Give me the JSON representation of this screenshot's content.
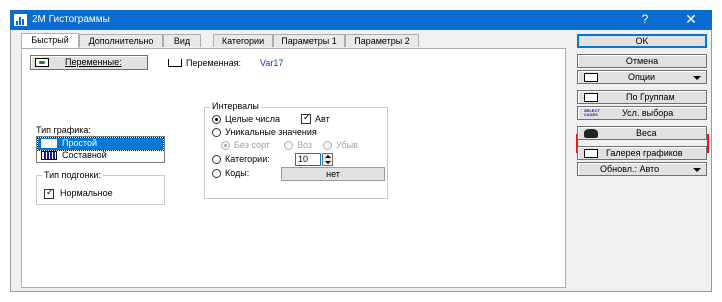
{
  "window": {
    "title": "2M Гистограммы",
    "help_label": "?",
    "close_label": "✕"
  },
  "tabs": [
    "Быстрый",
    "Дополнительно",
    "Вид",
    "Категории",
    "Параметры 1",
    "Параметры 2"
  ],
  "quick": {
    "variables_button": "Переменные:",
    "variable_label": "Переменная:",
    "variable_value": "Var17",
    "graph_type_label": "Тип графика:",
    "graph_types": [
      {
        "label": "Простой",
        "selected": true
      },
      {
        "label": "Составной",
        "selected": false
      }
    ],
    "fit_label": "Тип подгонки:",
    "fit_value": "Нормальное",
    "intervals": {
      "label": "Интервалы",
      "integer_label": "Целые числа",
      "auto_label": "Авт",
      "unique_label": "Уникальные значения",
      "sort_none_label": "Без сорт",
      "sort_asc_label": "Воз",
      "sort_desc_label": "Убыв",
      "categories_label": "Категории:",
      "categories_value": "10",
      "codes_label": "Коды:",
      "codes_button": "нет"
    }
  },
  "right_buttons": {
    "ok": "OK",
    "cancel": "Отмена",
    "options": "Опции",
    "by_groups": "По Группам",
    "select_cases": "Усл. выбора",
    "select_cases_icon_text": "SELECT CASES",
    "weights": "Веса",
    "gallery": "Галерея графиков",
    "update": "Обновл.: Авто"
  },
  "colors": {
    "titlebar": "#0a6cd0",
    "selection": "#0078d7",
    "highlight_box": "#e01818",
    "variable_value": "#1a3aa8"
  }
}
